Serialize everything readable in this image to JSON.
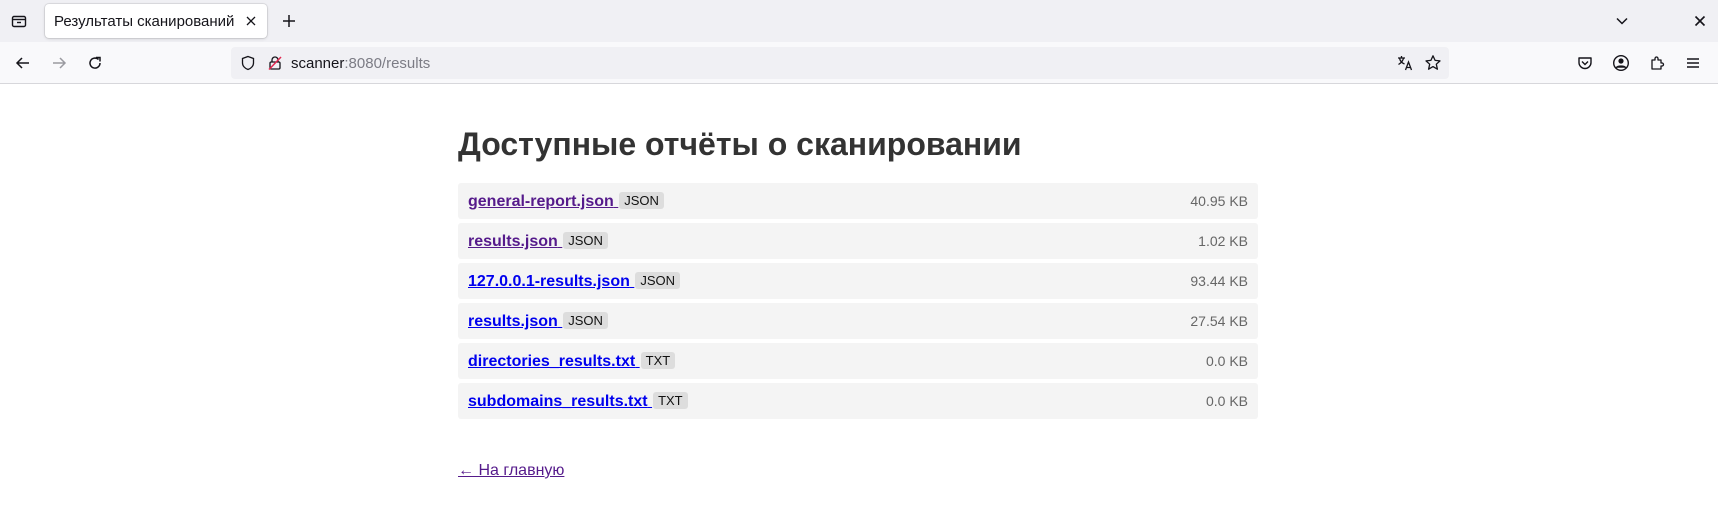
{
  "browser": {
    "tab": {
      "title": "Результаты сканирований",
      "favicon": "none"
    },
    "url": {
      "host": "scanner",
      "rest": ":8080/results"
    },
    "icons": {
      "tab_list": "tab-list-icon",
      "close_tab": "close-icon",
      "new_tab": "plus-icon",
      "list_all_tabs": "chevron-down-icon",
      "close_window": "close-icon",
      "back": "arrow-left-icon",
      "forward": "arrow-right-icon",
      "reload": "reload-icon",
      "tracking_protection": "shield-icon",
      "connection": "insecure-lock-icon",
      "translate": "translate-icon",
      "bookmark": "star-icon",
      "pocket": "pocket-icon",
      "account": "account-icon",
      "extensions": "puzzle-icon",
      "menu": "hamburger-icon"
    }
  },
  "page": {
    "title": "Доступные отчёты о сканировании",
    "files": [
      {
        "name": "general-report.json",
        "type": "JSON",
        "size": "40.95 KB",
        "visited": true
      },
      {
        "name": "results.json",
        "type": "JSON",
        "size": "1.02 KB",
        "visited": true
      },
      {
        "name": "127.0.0.1-results.json",
        "type": "JSON",
        "size": "93.44 KB",
        "visited": false
      },
      {
        "name": "results.json",
        "type": "JSON",
        "size": "27.54 KB",
        "visited": false
      },
      {
        "name": "directories_results.txt",
        "type": "TXT",
        "size": "0.0 KB",
        "visited": false
      },
      {
        "name": "subdomains_results.txt",
        "type": "TXT",
        "size": "0.0 KB",
        "visited": false
      }
    ],
    "back_link": "← На главную"
  },
  "colors": {
    "link": "#0000ee",
    "visited": "#551a8b",
    "row_bg": "#f4f4f4",
    "badge_bg": "#dddddd",
    "title": "#333333"
  }
}
